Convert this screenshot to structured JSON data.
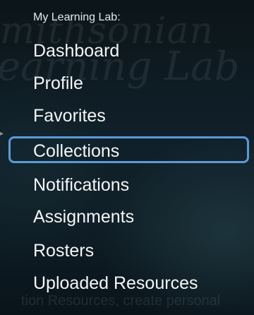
{
  "background_text": {
    "line1": "mithsonian",
    "line2": "earning Lab",
    "footer": "tion Resources, create personal"
  },
  "menu": {
    "heading": "My Learning Lab:",
    "selected_index": 3,
    "accent_color": "#5b9bd5",
    "items": [
      {
        "label": "Dashboard"
      },
      {
        "label": "Profile"
      },
      {
        "label": "Favorites"
      },
      {
        "label": "Collections"
      },
      {
        "label": "Notifications"
      },
      {
        "label": "Assignments"
      },
      {
        "label": "Rosters"
      },
      {
        "label": "Uploaded Resources"
      }
    ]
  }
}
